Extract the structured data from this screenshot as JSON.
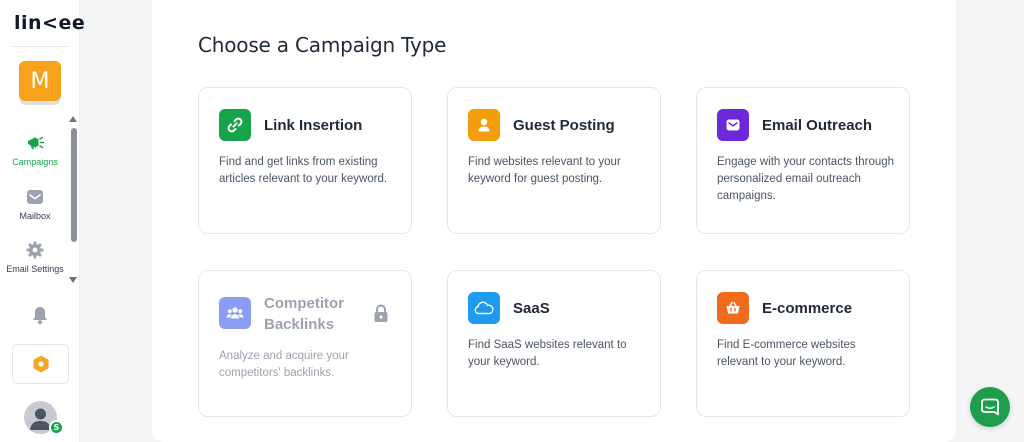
{
  "app": {
    "logo_text": "lin<ee"
  },
  "workspace": {
    "initial": "M",
    "color": "#f7a21b"
  },
  "sidebar": {
    "items": [
      {
        "label": "Campaigns",
        "icon": "megaphone-icon",
        "active": true
      },
      {
        "label": "Mailbox",
        "icon": "mail-icon",
        "active": false
      },
      {
        "label": "Email Settings",
        "icon": "gear-icon",
        "active": false
      }
    ],
    "notifications_icon": "bell-icon",
    "upgrade_icon": "hexagon-icon",
    "user_badge": "S"
  },
  "main": {
    "title": "Choose a Campaign Type",
    "cards": [
      {
        "title": "Link Insertion",
        "description": "Find and get links from existing articles relevant to your keyword.",
        "icon": "link-icon",
        "color": "#16a34a",
        "locked": false
      },
      {
        "title": "Guest Posting",
        "description": "Find websites relevant to your keyword for guest posting.",
        "icon": "user-icon",
        "color": "#f59e0b",
        "locked": false
      },
      {
        "title": "Email Outreach",
        "description": "Engage with your contacts through personalized email outreach campaigns.",
        "icon": "envelope-icon",
        "color": "#6d28d9",
        "locked": false
      },
      {
        "title": "Competitor Backlinks",
        "description": "Analyze and acquire your competitors' backlinks.",
        "icon": "users-icon",
        "color": "#8b9cf7",
        "locked": true
      },
      {
        "title": "SaaS",
        "description": "Find SaaS websites relevant to your keyword.",
        "icon": "saas-cloud-icon",
        "color": "#1d9bf0",
        "locked": false
      },
      {
        "title": "E-commerce",
        "description": "Find E-commerce websites relevant to your keyword.",
        "icon": "basket-icon",
        "color": "#f26b1d",
        "locked": false
      }
    ]
  },
  "chat": {
    "icon": "chat-icon",
    "color": "#1e9e4a"
  }
}
